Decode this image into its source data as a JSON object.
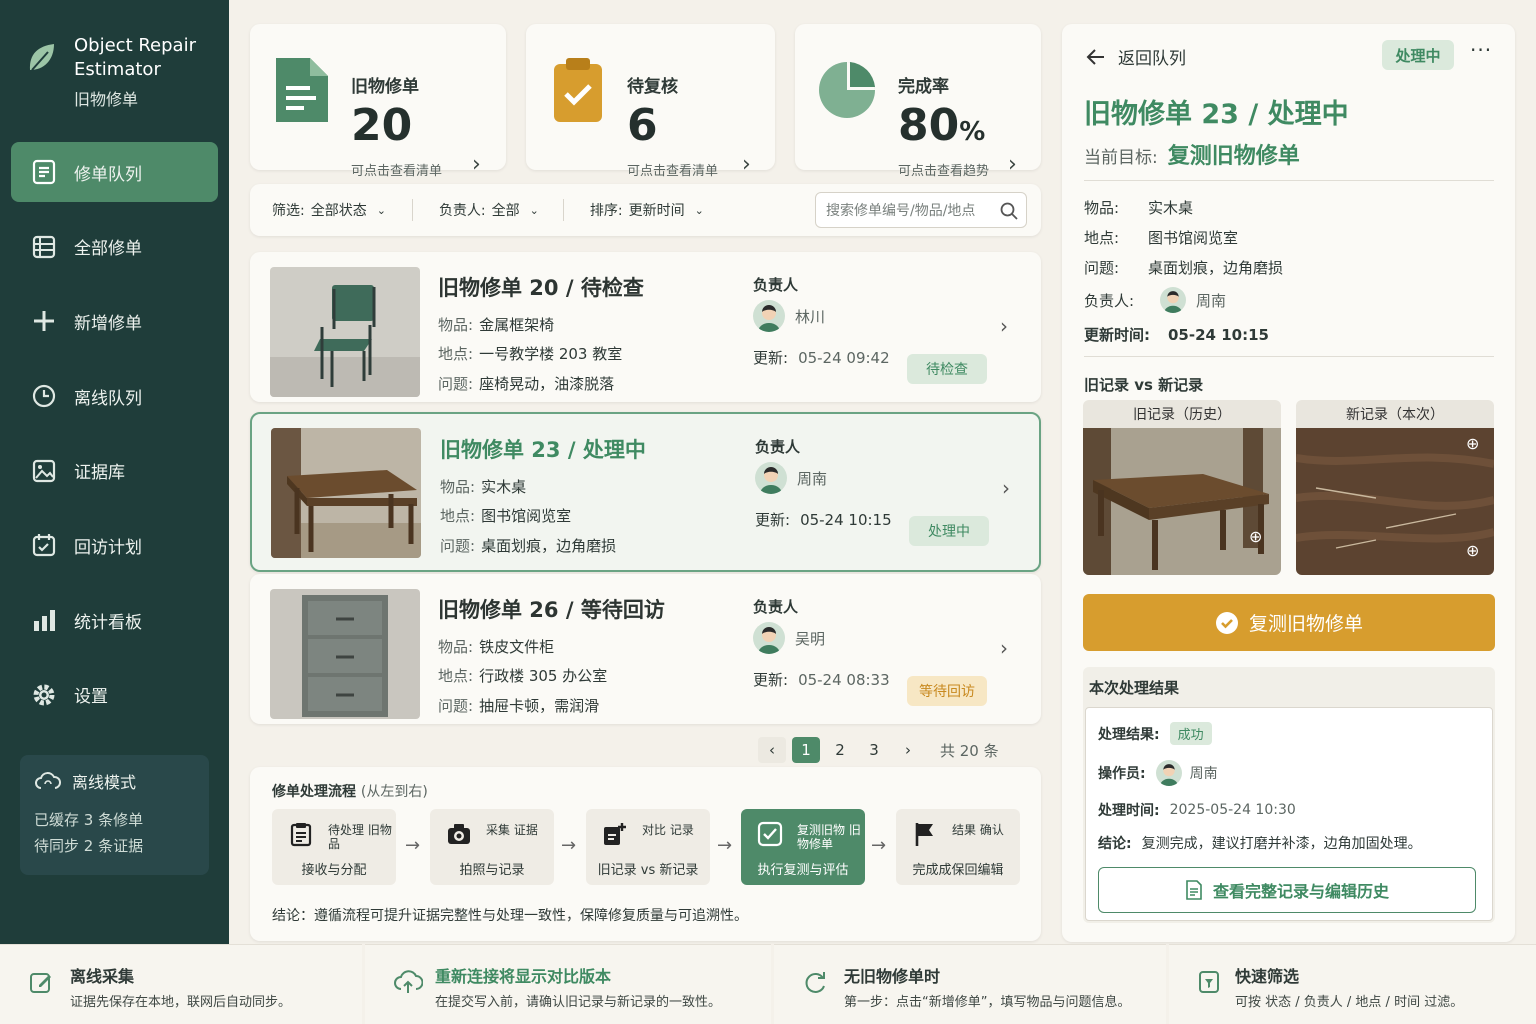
{
  "app": {
    "name": "Object Repair Estimator",
    "subtitle": "旧物修单"
  },
  "nav": [
    {
      "label": "修单队列",
      "icon": "list-icon",
      "active": true
    },
    {
      "label": "全部修单",
      "icon": "grid-icon"
    },
    {
      "label": "新增修单",
      "icon": "plus-icon"
    },
    {
      "label": "离线队列",
      "icon": "clock-icon"
    },
    {
      "label": "证据库",
      "icon": "image-icon"
    },
    {
      "label": "回访计划",
      "icon": "calendar-icon"
    },
    {
      "label": "统计看板",
      "icon": "bar-chart-icon"
    },
    {
      "label": "设置",
      "icon": "gear-icon"
    }
  ],
  "offline": {
    "title": "离线模式",
    "line1": "已缓存 3 条修单",
    "line2": "待同步 2 条证据"
  },
  "stats": [
    {
      "label": "旧物修单",
      "value": "20",
      "hint": "可点击查看清单"
    },
    {
      "label": "待复核",
      "value": "6",
      "hint": "可点击查看清单"
    },
    {
      "label": "完成率",
      "value": "80",
      "unit": "%",
      "hint": "可点击查看趋势"
    }
  ],
  "filter": {
    "status_label": "筛选:",
    "status_value": "全部状态",
    "owner_label": "负责人:",
    "owner_value": "全部",
    "sort_label": "排序:",
    "sort_value": "更新时间",
    "search_placeholder": "搜索修单编号/物品/地点"
  },
  "labels": {
    "item": "物品:",
    "location": "地点:",
    "issue": "问题:",
    "owner": "负责人",
    "updated": "更新:"
  },
  "orders": [
    {
      "title": "旧物修单 20 / 待检查",
      "item": "金属框架椅",
      "location": "一号教学楼 203 教室",
      "issue": "座椅晃动，油漆脱落",
      "owner": "林川",
      "updated": "05-24 09:42",
      "status": "待检查",
      "status_tone": "green"
    },
    {
      "title": "旧物修单 23 / 处理中",
      "item": "实木桌",
      "location": "图书馆阅览室",
      "issue": "桌面划痕，边角磨损",
      "owner": "周南",
      "updated": "05-24 10:15",
      "status": "处理中",
      "status_tone": "green"
    },
    {
      "title": "旧物修单 26 / 等待回访",
      "item": "铁皮文件柜",
      "location": "行政楼 305 办公室",
      "issue": "抽屉卡顿，需润滑",
      "owner": "吴明",
      "updated": "05-24 08:33",
      "status": "等待回访",
      "status_tone": "yellow"
    }
  ],
  "pager": {
    "prev": "‹",
    "pages": [
      "1",
      "2",
      "3"
    ],
    "next": "›",
    "total": "共 20 条"
  },
  "flow": {
    "title": "修单处理流程",
    "title_note": "(从左到右)",
    "steps": [
      {
        "top": "待处理 旧物品",
        "bottom": "接收与分配"
      },
      {
        "top": "采集 证据",
        "bottom": "拍照与记录"
      },
      {
        "top": "对比 记录",
        "bottom": "旧记录 vs 新记录"
      },
      {
        "top": "复测旧物 旧物修单",
        "bottom": "执行复测与评估"
      },
      {
        "top": "结果 确认",
        "bottom": "完成成保回编辑"
      }
    ],
    "conclusion": "结论：遵循流程可提升证据完整性与处理一致性，保障修复质量与可追溯性。"
  },
  "detail": {
    "back": "返回队列",
    "status": "处理中",
    "more": "···",
    "title": "旧物修单 23 / 处理中",
    "goal_label": "当前目标:",
    "goal_value": "复测旧物修单",
    "item_label": "物品:",
    "item": "实木桌",
    "location_label": "地点:",
    "location": "图书馆阅览室",
    "issue_label": "问题:",
    "issue": "桌面划痕，边角磨损",
    "owner_label": "负责人:",
    "owner": "周南",
    "updated_label": "更新时间:",
    "updated": "05-24 10:15",
    "compare_title": "旧记录 vs 新记录",
    "old_label": "旧记录（历史）",
    "new_label": "新记录（本次）",
    "action": "复测旧物修单",
    "result_title": "本次处理结果",
    "result_label": "处理结果:",
    "result": "成功",
    "operator_label": "操作员:",
    "operator": "周南",
    "time_label": "处理时间:",
    "time": "2025-05-24 10:30",
    "conclusion_label": "结论:",
    "conclusion": "复测完成，建议打磨并补漆，边角加固处理。",
    "history_button": "查看完整记录与编辑历史"
  },
  "tips": [
    {
      "title": "离线采集",
      "body": "证据先保存在本地，联网后自动同步。"
    },
    {
      "title": "重新连接将显示对比版本",
      "body": "在提交写入前，请确认旧记录与新记录的一致性。"
    },
    {
      "title": "无旧物修单时",
      "body": "第一步：点击“新增修单”，填写物品与问题信息。"
    },
    {
      "title": "快速筛选",
      "body": "可按 状态 / 负责人 / 地点 / 时间 过滤。"
    }
  ],
  "colors": {
    "sidebar": "#1f3d3a",
    "accent": "#4e8a69",
    "warning": "#d79d2e",
    "background": "#f4f1ea"
  }
}
